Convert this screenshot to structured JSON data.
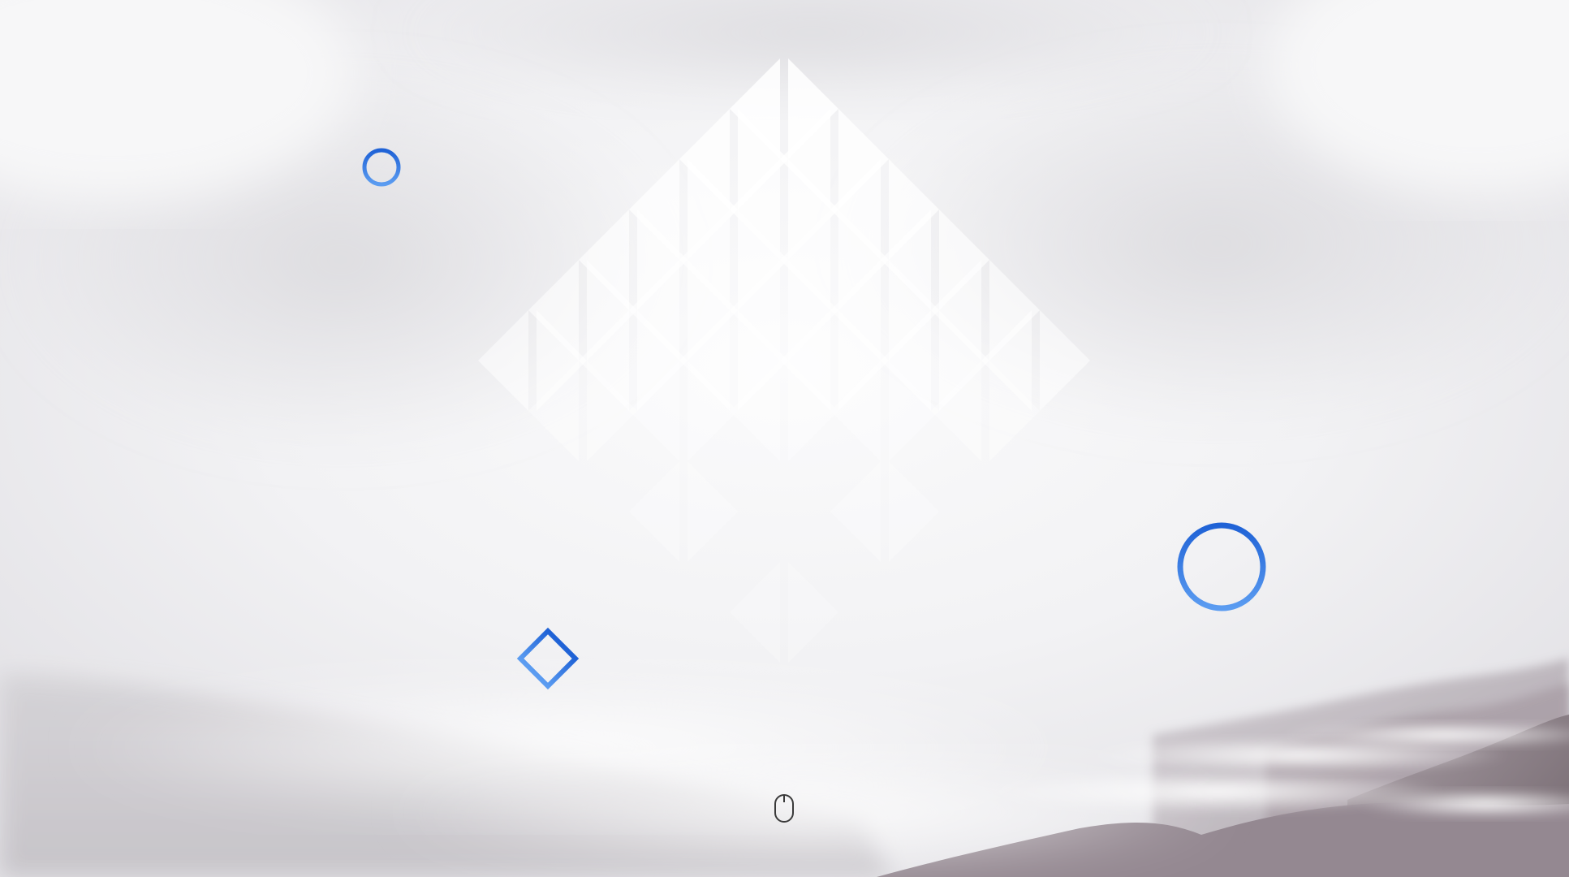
{
  "page": {
    "theme": "misty-mountains-hero",
    "colors": {
      "accent": "#2f73e0",
      "accent_light": "#5a9af0",
      "fog": "#f4f4f6",
      "mountain": "#9a8f98",
      "icon": "#333333"
    }
  },
  "decorations": {
    "pyramid_pattern": "white-triangle-pyramid",
    "shapes": [
      "ring-small",
      "ring-large",
      "diamond-outline"
    ]
  },
  "scroll_hint": {
    "icon": "mouse-icon"
  }
}
